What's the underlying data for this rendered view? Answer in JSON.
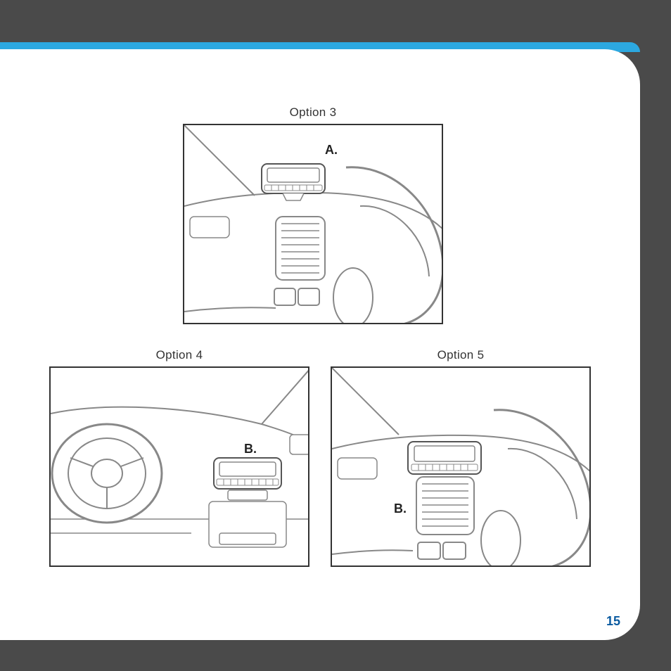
{
  "figures": {
    "top": {
      "title": "Option 3",
      "callout": "A."
    },
    "left": {
      "title": "Option 4",
      "callout": "B."
    },
    "right": {
      "title": "Option 5",
      "callout": "B."
    }
  },
  "pageNumber": "15"
}
